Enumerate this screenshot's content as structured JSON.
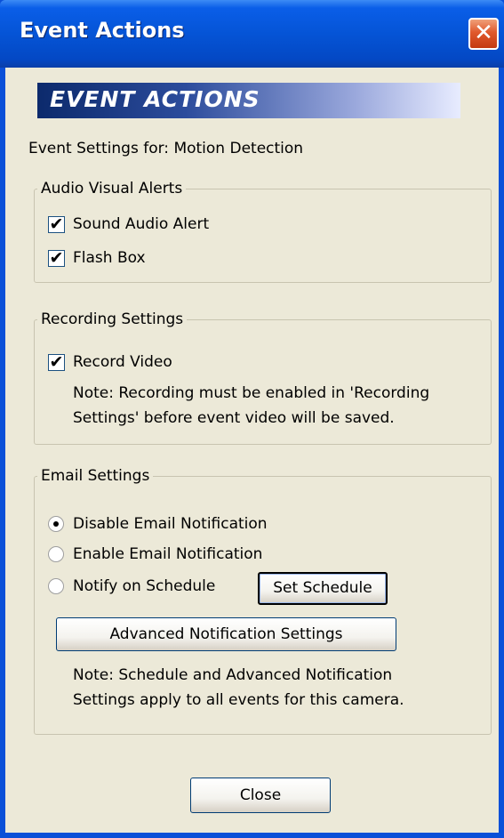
{
  "window": {
    "title": "Event Actions",
    "close_glyph": "✕",
    "banner": "EVENT ACTIONS",
    "titlebar_color": "#0554d6",
    "background_color": "#ece9d8"
  },
  "event_settings_label": "Event Settings for: Motion Detection",
  "audio_visual": {
    "legend": "Audio Visual Alerts",
    "sound_audio_alert": {
      "label": "Sound Audio Alert",
      "checked": true
    },
    "flash_box": {
      "label": "Flash Box",
      "checked": true
    }
  },
  "recording": {
    "legend": "Recording Settings",
    "record_video": {
      "label": "Record Video",
      "checked": true
    },
    "note_line1": "Note: Recording must be enabled in 'Recording",
    "note_line2": "Settings' before event video will be saved."
  },
  "email": {
    "legend": "Email Settings",
    "options": [
      {
        "label": "Disable Email Notification",
        "selected": true
      },
      {
        "label": "Enable Email Notification",
        "selected": false
      },
      {
        "label": "Notify on Schedule",
        "selected": false
      }
    ],
    "set_schedule_button": "Set Schedule",
    "advanced_button": "Advanced Notification Settings",
    "note_line1": "Note: Schedule and Advanced Notification",
    "note_line2": "Settings apply to all events for this camera."
  },
  "close_button": "Close",
  "check_glyph": "✔"
}
